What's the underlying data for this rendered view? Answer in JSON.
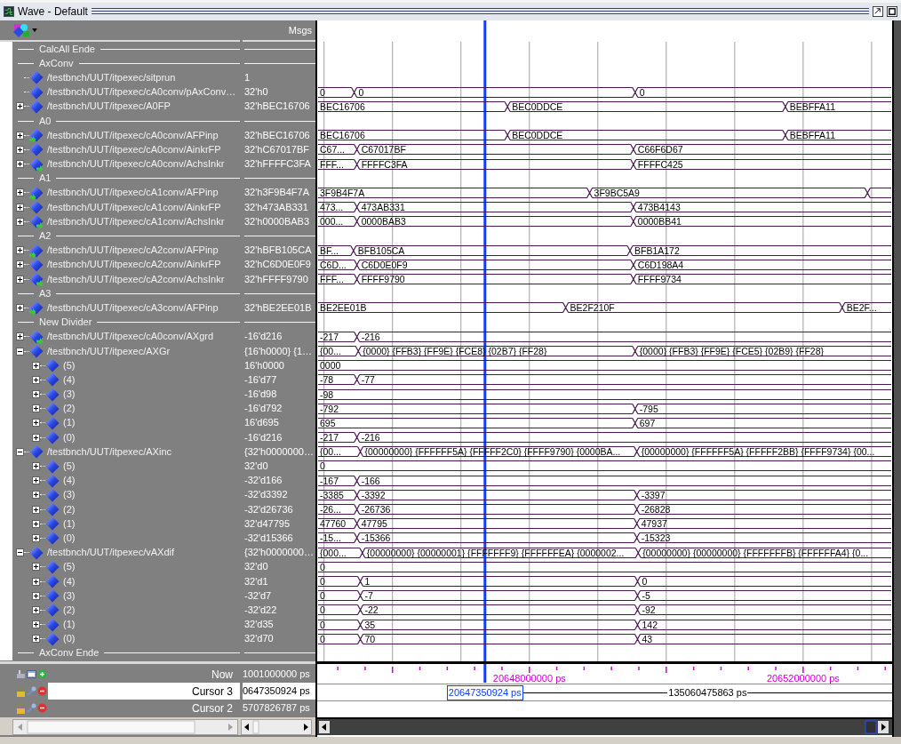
{
  "window": {
    "title": "Wave - Default"
  },
  "header": {
    "value_column": "Msgs"
  },
  "rows": [
    {
      "kind": "divider",
      "label": "CalcAll Ende"
    },
    {
      "kind": "divider",
      "label": "AxConv"
    },
    {
      "kind": "signal",
      "name": "/testbnch/UUT/itpexec/sitprun",
      "value": "1"
    },
    {
      "kind": "signal",
      "name": "/testbnch/UUT/itpexec/cA0conv/pAxConv…",
      "value": "32'h0",
      "wave": [
        "0",
        "0",
        "0"
      ]
    },
    {
      "kind": "signal",
      "name": "/testbnch/UUT/itpexec/A0FP",
      "expanded": false,
      "value": "32'hBEC16706",
      "wave": [
        "BEC16706",
        "BEC0DDCE",
        "BEBFFA11"
      ]
    },
    {
      "kind": "divider",
      "label": "A0"
    },
    {
      "kind": "in_port",
      "name": "/testbnch/UUT/itpexec/cA0conv/AFPinp",
      "expanded": false,
      "value": "32'hBEC16706",
      "wave": [
        "BEC16706",
        "BEC0DDCE",
        "BEBFFA11"
      ]
    },
    {
      "kind": "signal",
      "name": "/testbnch/UUT/itpexec/cA0conv/AinkrFP",
      "expanded": false,
      "value": "32'hC67017BF",
      "wave": [
        "C67...",
        "C67017BF",
        "C66F6D67"
      ]
    },
    {
      "kind": "out_port",
      "name": "/testbnch/UUT/itpexec/cA0conv/AchsInkr",
      "expanded": false,
      "value": "32'hFFFFC3FA",
      "wave": [
        "FFF...",
        "FFFFC3FA",
        "FFFFC425"
      ]
    },
    {
      "kind": "divider",
      "label": "A1"
    },
    {
      "kind": "in_port",
      "name": "/testbnch/UUT/itpexec/cA1conv/AFPinp",
      "expanded": false,
      "value": "32'h3F9B4F7A",
      "wave": [
        "3F9B4F7A",
        "3F9BC5A9"
      ]
    },
    {
      "kind": "signal",
      "name": "/testbnch/UUT/itpexec/cA1conv/AinkrFP",
      "expanded": false,
      "value": "32'h473AB331",
      "wave": [
        "473...",
        "473AB331",
        "473B4143"
      ]
    },
    {
      "kind": "out_port",
      "name": "/testbnch/UUT/itpexec/cA1conv/AchsInkr",
      "expanded": false,
      "value": "32'h0000BAB3",
      "wave": [
        "000...",
        "0000BAB3",
        "0000BB41"
      ]
    },
    {
      "kind": "divider",
      "label": "A2"
    },
    {
      "kind": "in_port",
      "name": "/testbnch/UUT/itpexec/cA2conv/AFPinp",
      "expanded": false,
      "value": "32'hBFB105CA",
      "wave": [
        "BF...",
        "BFB105CA",
        "BFB1A172"
      ]
    },
    {
      "kind": "signal",
      "name": "/testbnch/UUT/itpexec/cA2conv/AinkrFP",
      "expanded": false,
      "value": "32'hC6D0E0F9",
      "wave": [
        "C6D...",
        "C6D0E0F9",
        "C6D198A4"
      ]
    },
    {
      "kind": "out_port",
      "name": "/testbnch/UUT/itpexec/cA2conv/AchsInkr",
      "expanded": false,
      "value": "32'hFFFF9790",
      "wave": [
        "FFF...",
        "FFFF9790",
        "FFFF9734"
      ]
    },
    {
      "kind": "divider",
      "label": "A3"
    },
    {
      "kind": "in_port",
      "name": "/testbnch/UUT/itpexec/cA3conv/AFPinp",
      "expanded": false,
      "value": "32'hBE2EE01B",
      "wave": [
        "BE2EE01B",
        "BE2F210F",
        "BE2F..."
      ]
    },
    {
      "kind": "divider",
      "label": "New Divider"
    },
    {
      "kind": "out_port",
      "name": "/testbnch/UUT/itpexec/cA0conv/AXgrd",
      "expanded": false,
      "value": "-16'd216",
      "wave": [
        "-217",
        "-216"
      ]
    },
    {
      "kind": "signal",
      "name": "/testbnch/UUT/itpexec/AXGr",
      "expanded": true,
      "value": "{16'h0000} {1…",
      "wave": [
        "{00...",
        "{0000} {FFB3} {FF9E} {FCE8} {02B7} {FF28}",
        "{0000} {FFB3} {FF9E} {FCE5} {02B9} {FF28}"
      ],
      "children": [
        {
          "kind": "signal",
          "name": "(5)",
          "expanded": false,
          "value": "16'h0000",
          "wave": [
            "0000"
          ]
        },
        {
          "kind": "signal",
          "name": "(4)",
          "expanded": false,
          "value": "-16'd77",
          "wave": [
            "-78",
            "-77"
          ]
        },
        {
          "kind": "signal",
          "name": "(3)",
          "expanded": false,
          "value": "-16'd98",
          "wave": [
            "-98"
          ]
        },
        {
          "kind": "signal",
          "name": "(2)",
          "expanded": false,
          "value": "-16'd792",
          "wave": [
            "-792",
            "-795"
          ]
        },
        {
          "kind": "signal",
          "name": "(1)",
          "expanded": false,
          "value": "16'd695",
          "wave": [
            "695",
            "697"
          ]
        },
        {
          "kind": "signal",
          "name": "(0)",
          "expanded": false,
          "value": "-16'd216",
          "wave": [
            "-217",
            "-216"
          ]
        }
      ]
    },
    {
      "kind": "signal",
      "name": "/testbnch/UUT/itpexec/AXinc",
      "expanded": true,
      "value": "{32'h0000000…",
      "wave": [
        "{00...",
        "{00000000} {FFFFFF5A} {FFFFF2C0} {FFFF9790} {0000BA...",
        "{00000000} {FFFFFF5A} {FFFFF2BB} {FFFF9734} {00..."
      ],
      "children": [
        {
          "kind": "signal",
          "name": "(5)",
          "expanded": false,
          "value": "32'd0",
          "wave": [
            "0"
          ]
        },
        {
          "kind": "signal",
          "name": "(4)",
          "expanded": false,
          "value": "-32'd166",
          "wave": [
            "-167",
            "-166"
          ]
        },
        {
          "kind": "signal",
          "name": "(3)",
          "expanded": false,
          "value": "-32'd3392",
          "wave": [
            "-3385",
            "-3392",
            "-3397"
          ]
        },
        {
          "kind": "signal",
          "name": "(2)",
          "expanded": false,
          "value": "-32'd26736",
          "wave": [
            "-26...",
            "-26736",
            "-26828"
          ]
        },
        {
          "kind": "signal",
          "name": "(1)",
          "expanded": false,
          "value": "32'd47795",
          "wave": [
            "47760",
            "47795",
            "47937"
          ]
        },
        {
          "kind": "signal",
          "name": "(0)",
          "expanded": false,
          "value": "-32'd15366",
          "wave": [
            "-15...",
            "-15366",
            "-15323"
          ]
        }
      ]
    },
    {
      "kind": "signal",
      "name": "/testbnch/UUT/itpexec/vAXdif",
      "expanded": true,
      "value": "{32'h0000000…",
      "wave": [
        "{000...",
        "{00000000} {00000001} {FFFFFFF9} {FFFFFFEA} {0000002...",
        "{00000000} {00000000} {FFFFFFFB} {FFFFFFA4} {0..."
      ],
      "children": [
        {
          "kind": "signal",
          "name": "(5)",
          "expanded": false,
          "value": "32'd0",
          "wave": [
            "0"
          ]
        },
        {
          "kind": "signal",
          "name": "(4)",
          "expanded": false,
          "value": "32'd1",
          "wave": [
            "0",
            "1",
            "0"
          ]
        },
        {
          "kind": "signal",
          "name": "(3)",
          "expanded": false,
          "value": "-32'd7",
          "wave": [
            "0",
            "-7",
            "-5"
          ]
        },
        {
          "kind": "signal",
          "name": "(2)",
          "expanded": false,
          "value": "-32'd22",
          "wave": [
            "0",
            "-22",
            "-92"
          ]
        },
        {
          "kind": "signal",
          "name": "(1)",
          "expanded": false,
          "value": "32'd35",
          "wave": [
            "0",
            "35",
            "142"
          ]
        },
        {
          "kind": "signal",
          "name": "(0)",
          "expanded": false,
          "value": "32'd70",
          "wave": [
            "0",
            "70",
            "43"
          ]
        }
      ]
    },
    {
      "kind": "divider",
      "label": "AxConv Ende"
    }
  ],
  "cursors": [
    {
      "kind": "now",
      "name": "Now",
      "value": "1001000000 ps",
      "selected": false
    },
    {
      "kind": "cursor",
      "name": "Cursor 3",
      "value": "0647350924 ps",
      "selected": true,
      "time_label": "20647350924 ps",
      "delta": "135060475863 ps"
    },
    {
      "kind": "cursor",
      "name": "Cursor 2",
      "value": "5707826787 ps",
      "selected": false
    }
  ],
  "timeline": {
    "labels": [
      "20648000000 ps",
      "20652000000 ps"
    ]
  }
}
